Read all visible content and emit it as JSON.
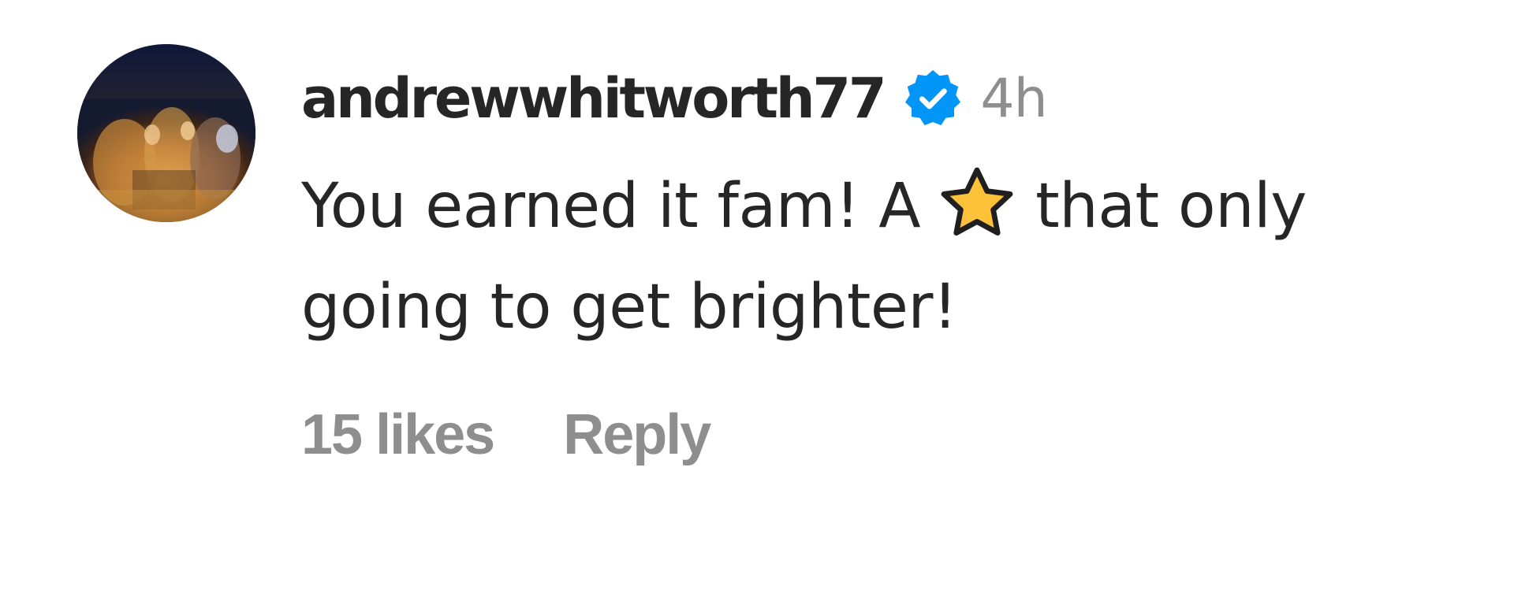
{
  "comment": {
    "author": {
      "username": "andrewwhitworth77",
      "verified": true,
      "avatar_icon": "profile-photo-avatar",
      "verified_icon": "verified-badge-icon",
      "verified_color": "#0095f6"
    },
    "timestamp": "4h",
    "text": {
      "line1_before": "You earned it fam! A",
      "emoji": "⭐",
      "emoji_icon": "star-emoji-icon",
      "line1_after": "that only",
      "line2": "going to get brighter!"
    },
    "likes_label": "15 likes",
    "reply_label": "Reply"
  },
  "colors": {
    "text_primary": "#262626",
    "text_secondary": "#8e8e8e",
    "star_fill": "#fdc23a",
    "background": "#ffffff"
  }
}
